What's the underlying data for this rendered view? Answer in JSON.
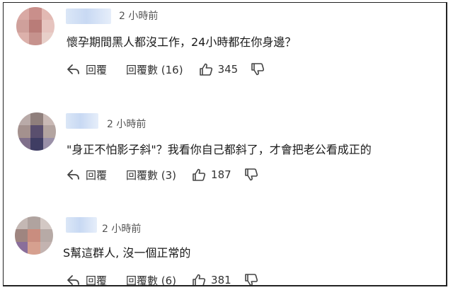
{
  "comments": [
    {
      "time": "2 小時前",
      "text": "懷孕期間黑人都沒工作，24小時都在你身邊？",
      "reply_label": "回覆",
      "replies_label": "回覆數 (16)",
      "likes": "345",
      "avatar_colors": [
        "#d9a9a4",
        "#c98f8b",
        "#e2b9b3",
        "#cfa09b",
        "#b97c78",
        "#e6c4bf",
        "#dcb1ab",
        "#c6928d",
        "#e8cfc9"
      ]
    },
    {
      "time": "2 小時前",
      "text": "\"身正不怕影子斜\"？我看你自己都斜了，才會把老公看成正的",
      "reply_label": "回覆",
      "replies_label": "回覆數 (3)",
      "likes": "187",
      "avatar_colors": [
        "#b9aaa8",
        "#8f7f7c",
        "#c9b9b5",
        "#a4918e",
        "#5a4f6e",
        "#b3a4a0",
        "#7f6f8a",
        "#3f3d63",
        "#9a90a8"
      ]
    },
    {
      "time": "2 小時前",
      "text": "S幫這群人, 沒一個正常的",
      "reply_label": "回覆",
      "replies_label": "回覆數 (6)",
      "likes": "381",
      "avatar_colors": [
        "#c4b8b4",
        "#b0a39f",
        "#d3c8c4",
        "#9f8580",
        "#c98d7f",
        "#b7aaa6",
        "#8a6e9a",
        "#d6a08f",
        "#c3b3b0"
      ]
    }
  ],
  "icons": {
    "reply": "reply-icon",
    "like": "thumbs-up-icon",
    "dislike": "thumbs-down-icon"
  }
}
